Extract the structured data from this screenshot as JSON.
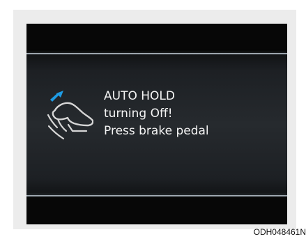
{
  "display": {
    "icon": "foot-on-brake-pedal-icon",
    "message_lines": [
      "AUTO HOLD",
      "turning Off!",
      "Press brake pedal"
    ]
  },
  "figure_code": "ODH048461N",
  "colors": {
    "screen_background": "#0a0a0a",
    "message_background": "#262a2e",
    "divider": "#c9d2da",
    "text": "#f4f4f4",
    "arrow": "#1e9be4",
    "icon_outline": "#d6d6d6"
  }
}
